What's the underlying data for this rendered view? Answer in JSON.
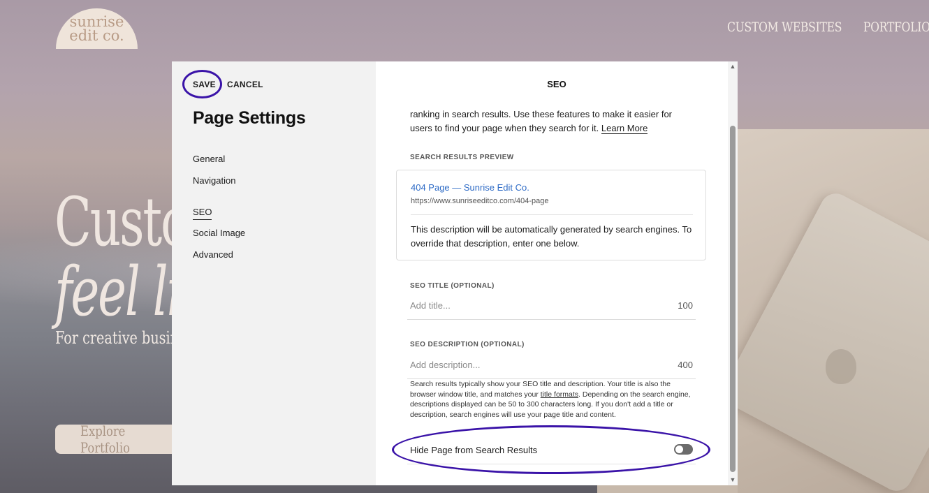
{
  "site": {
    "logo_line1": "sunrise",
    "logo_line2": "edit co.",
    "nav": [
      "CUSTOM WEBSITES",
      "PORTFOLIO"
    ],
    "hero_line1": "Custo",
    "hero_line2": "feel li",
    "hero_sub": "For creative busine",
    "cta_label": "Explore Portfolio"
  },
  "modal": {
    "save_label": "SAVE",
    "cancel_label": "CANCEL",
    "title": "Page Settings",
    "menu": [
      {
        "label": "General",
        "active": false
      },
      {
        "label": "Navigation",
        "active": false
      },
      {
        "label": "SEO",
        "active": true
      },
      {
        "label": "Social Image",
        "active": false
      },
      {
        "label": "Advanced",
        "active": false
      }
    ]
  },
  "seo": {
    "panel_title": "SEO",
    "intro_text": "ranking in search results. Use these features to make it easier for users to find your page when they search for it.",
    "learn_more": "Learn More",
    "preview_label": "SEARCH RESULTS PREVIEW",
    "preview_title": "404 Page — Sunrise Edit Co.",
    "preview_url": "https://www.sunriseeditco.com/404-page",
    "preview_desc": "This description will be automatically generated by search engines. To override that description, enter one below.",
    "title_label": "SEO TITLE (OPTIONAL)",
    "title_placeholder": "Add title...",
    "title_counter": "100",
    "desc_label": "SEO DESCRIPTION (OPTIONAL)",
    "desc_placeholder": "Add description...",
    "desc_counter": "400",
    "help_part1": "Search results typically show your SEO title and description. Your title is also the browser window title, and matches your",
    "help_link": "title formats",
    "help_part2": ". Depending on the search engine, descriptions displayed can be 50 to 300 characters long. If you don't add a title or description, search engines will use your page title and content.",
    "hide_label": "Hide Page from Search Results",
    "hide_enabled": false
  },
  "colors": {
    "highlight_ring": "#3a13a8",
    "link_blue": "#2e6bc6"
  }
}
